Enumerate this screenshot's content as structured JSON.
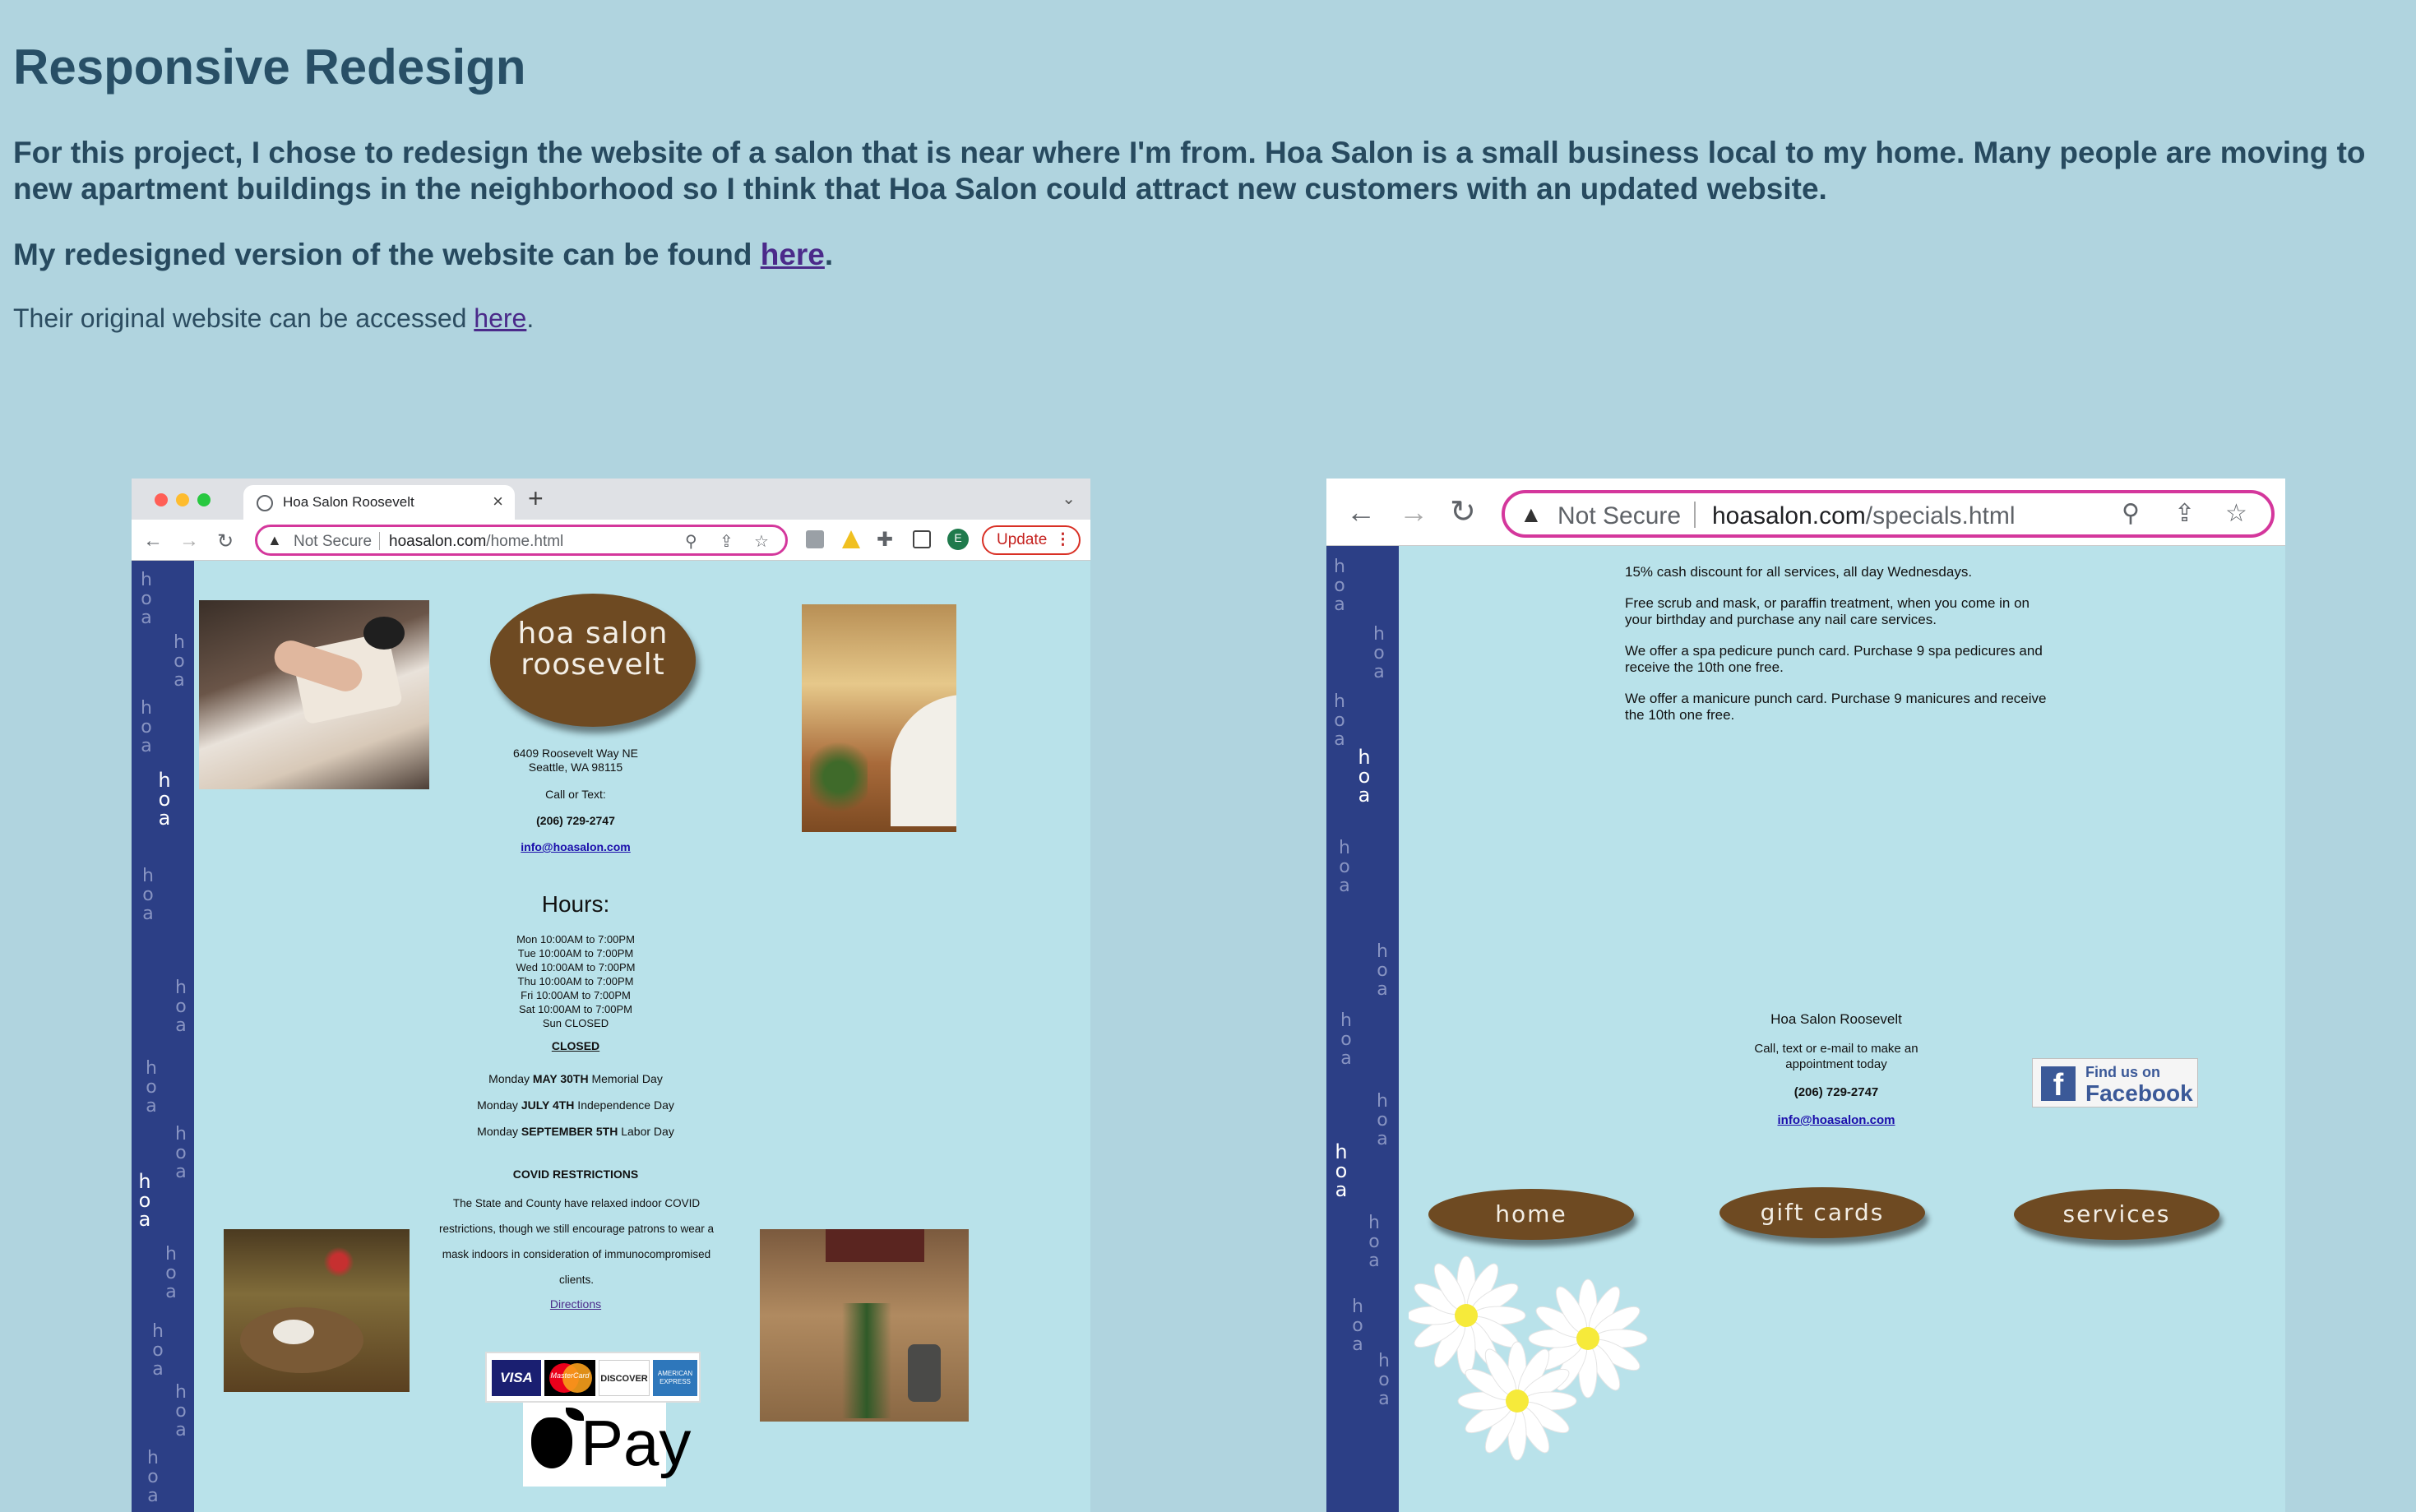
{
  "intro": {
    "title": "Responsive Redesign",
    "p1": "For this project, I chose to redesign the website of a salon that is near where I'm from. Hoa Salon is a small business local to my home. Many people are moving to new apartment buildings in the neighborhood so I think that Hoa Salon could attract new customers with an updated website.",
    "p2_before": "My redesigned version of the website can be found ",
    "p2_link": "here",
    "p2_after": ".",
    "p3_before": "Their original website can be accessed ",
    "p3_link": "here",
    "p3_after": "."
  },
  "shot1": {
    "tab_title": "Hoa Salon Roosevelt",
    "tab_close": "×",
    "tab_plus": "+",
    "tab_chevron": "⌄",
    "nav_back": "←",
    "nav_forward": "→",
    "nav_reload": "↻",
    "not_secure": "Not Secure",
    "url_domain": "hoasalon.com",
    "url_path": "/home.html",
    "update_label": "Update",
    "more_label": "⋮",
    "avatar_letter": "E",
    "logo_line1": "hoa salon",
    "logo_line2": "roosevelt",
    "address1": "6409 Roosevelt Way NE",
    "address2": "Seattle, WA 98115",
    "call_text": "Call or Text:",
    "phone": "(206) 729-2747",
    "email": "info@hoasalon.com",
    "hours_heading": "Hours:",
    "hours": [
      "Mon 10:00AM to 7:00PM",
      "Tue 10:00AM to 7:00PM",
      "Wed 10:00AM to 7:00PM",
      "Thu 10:00AM to 7:00PM",
      "Fri 10:00AM to 7:00PM",
      "Sat 10:00AM to 7:00PM",
      "Sun CLOSED"
    ],
    "closed_heading": "CLOSED",
    "closed_days": [
      {
        "pre": "Monday ",
        "date": "MAY 30TH",
        "post": " Memorial Day"
      },
      {
        "pre": "Monday ",
        "date": "JULY 4TH",
        "post": " Independence Day"
      },
      {
        "pre": "Monday ",
        "date": "SEPTEMBER 5TH",
        "post": " Labor Day"
      }
    ],
    "covid_heading": "COVID RESTRICTIONS",
    "covid_text": "The State and County have relaxed indoor COVID restrictions, though we still encourage patrons to wear a mask indoors in consideration of immunocompromised clients.",
    "directions": "Directions",
    "cards": [
      "VISA",
      "MasterCard",
      "DISCOVER",
      "AMERICAN EXPRESS"
    ],
    "applepay": "Pay",
    "hoa_letters": [
      "h",
      "o",
      "a"
    ]
  },
  "shot2": {
    "nav_back": "←",
    "nav_forward": "→",
    "nav_reload": "↻",
    "not_secure": "Not Secure",
    "url_domain": "hoasalon.com",
    "url_path": "/specials.html",
    "specials": [
      "15% cash discount for all services, all day Wednesdays.",
      "Free scrub and mask, or paraffin treatment, when you come in on your birthday and purchase any nail care services.",
      "We offer a spa pedicure punch card. Purchase 9 spa pedicures and receive the 10th one free.",
      "We offer a manicure punch card. Purchase 9 manicures and receive the 10th one free."
    ],
    "salon_name": "Hoa Salon Roosevelt",
    "contact_text": "Call, text or e-mail to make an appointment today",
    "phone": "(206) 729-2747",
    "email": "info@hoasalon.com",
    "fb_line1": "Find us on",
    "fb_line2": "Facebook",
    "fb_letter": "f",
    "nav": [
      "home",
      "gift cards",
      "services"
    ]
  },
  "colors": {
    "page_bg": "#b0d4df",
    "heading": "#284f66",
    "link": "#4b2a8a",
    "site_bg": "#b9e2ea",
    "strip": "#2c3f86",
    "oval": "#6e4a22",
    "omnibox_highlight": "#d4379c"
  }
}
